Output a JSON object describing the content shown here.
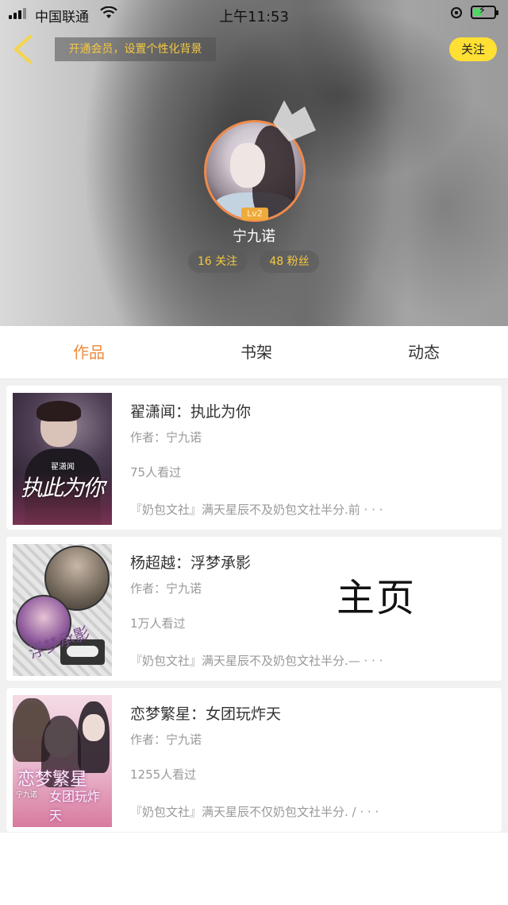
{
  "status_bar": {
    "carrier": "中国联通",
    "time": "上午11:53"
  },
  "header": {
    "vip_banner": "开通会员，设置个性化背景",
    "follow_label": "关注",
    "level": "Lv2",
    "username": "宁九诺",
    "following": "16 关注",
    "fans": "48 粉丝"
  },
  "tabs": [
    {
      "label": "作品",
      "active": true
    },
    {
      "label": "书架",
      "active": false
    },
    {
      "label": "动态",
      "active": false
    }
  ],
  "works": [
    {
      "title": "翟潇闻：执此为你",
      "author": "作者：宁九诺",
      "reads": "75人看过",
      "summary": "『奶包文社』满天星辰不及奶包文社半分.前 · · ·",
      "cover_text": "执此为你",
      "cover_subtext": "翟潇闻"
    },
    {
      "title": "杨超越：浮梦承影",
      "author": "作者：宁九诺",
      "reads": "1万人看过",
      "summary": "『奶包文社』满天星辰不及奶包文社半分.— · · ·",
      "cover_text": "浮梦承影"
    },
    {
      "title": "恋梦繁星：女团玩炸天",
      "author": "作者：宁九诺",
      "reads": "1255人看过",
      "summary": "『奶包文社』满天星辰不仅奶包文社半分. / · · ·",
      "cover_text": "恋梦繁星",
      "cover_subtext": "女团玩炸天",
      "cover_author": "宁九诺"
    }
  ],
  "watermark": "主页",
  "colors": {
    "accent": "#f08a3c",
    "follow": "#ffe033",
    "gold_text": "#f5c842"
  }
}
